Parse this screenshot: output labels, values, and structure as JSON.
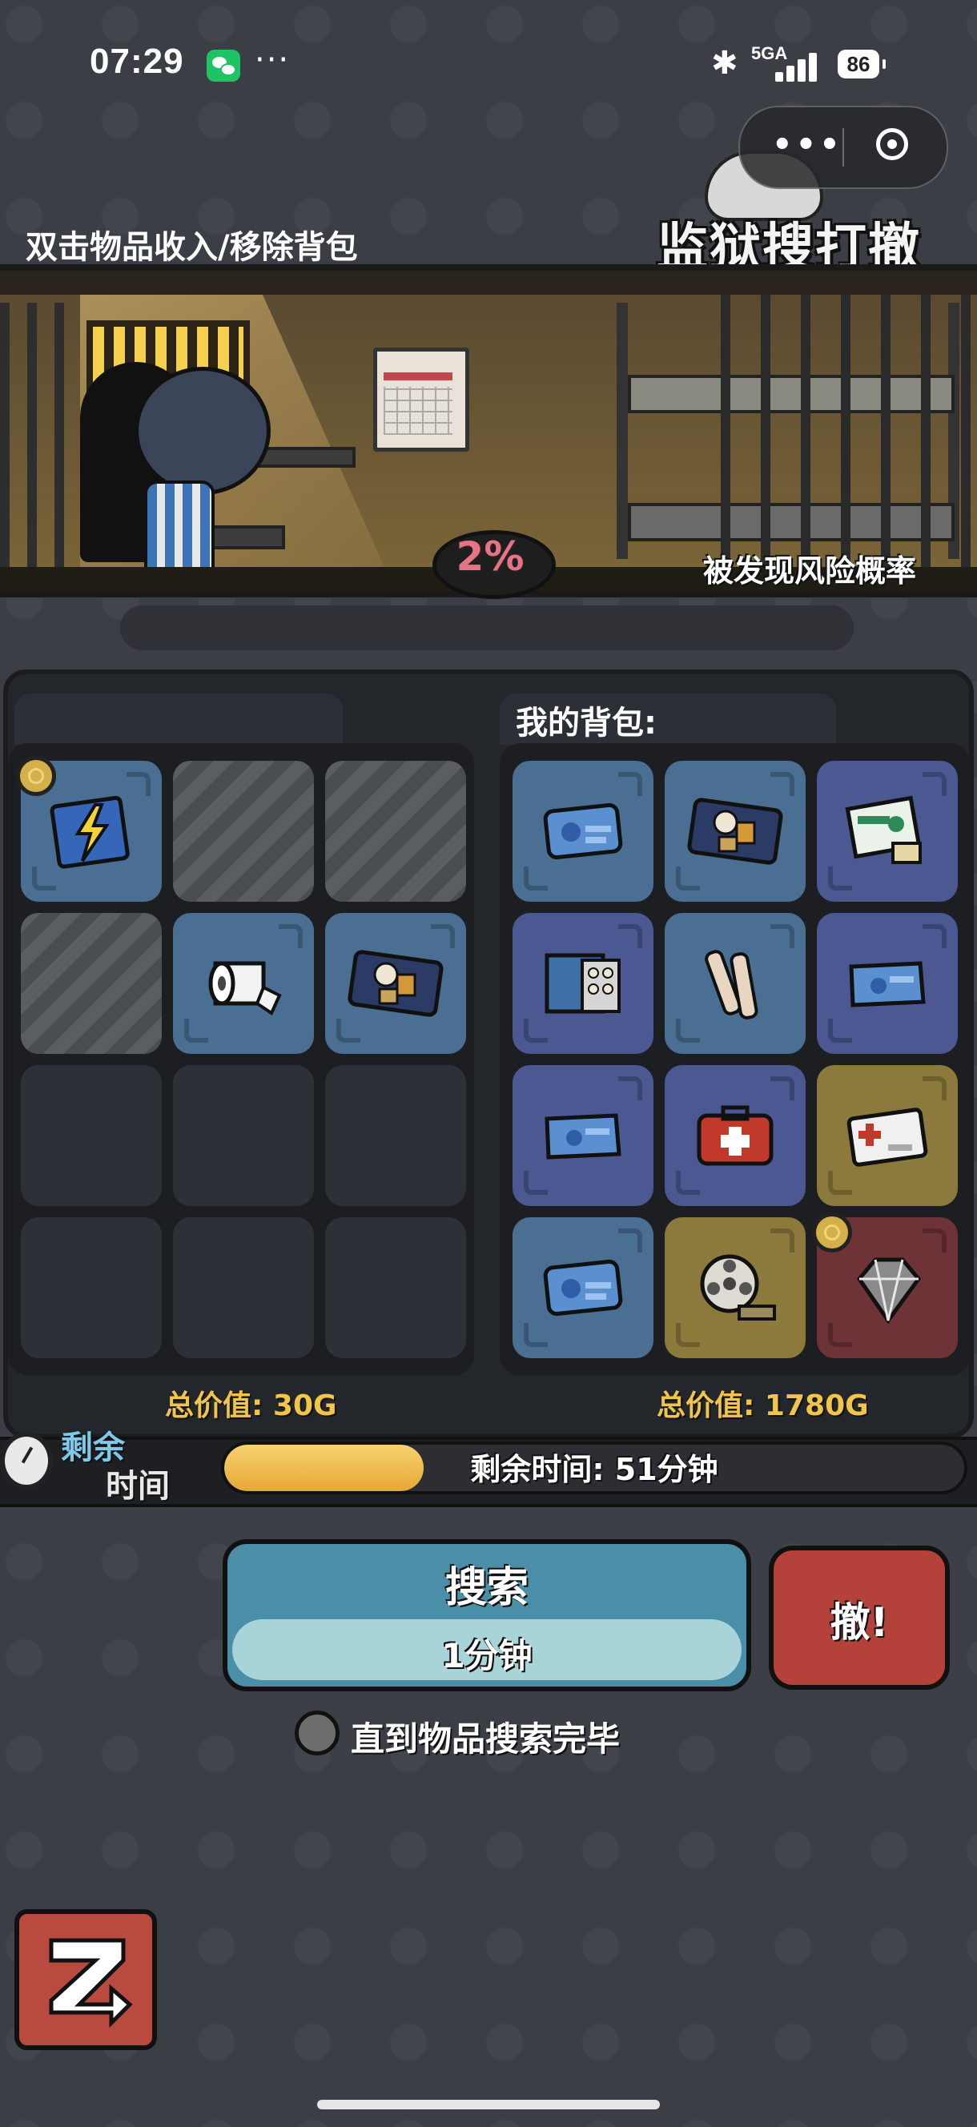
{
  "status": {
    "time": "07:29",
    "network": "5GA",
    "battery": "86"
  },
  "header": {
    "hint": "双击物品收入/移除背包",
    "game_logo": "监狱搜打撤"
  },
  "scene": {
    "risk_percent": "2%",
    "risk_label": "被发现风险概率"
  },
  "panels": {
    "right_title": "我的背包:",
    "left_total": "总价值: 30G",
    "right_total": "总价值: 1780G"
  },
  "left_grid": [
    {
      "state": "item",
      "color": "blue",
      "icon": "lightning-poster-icon",
      "coin": true
    },
    {
      "state": "hatched"
    },
    {
      "state": "hatched"
    },
    {
      "state": "hatched"
    },
    {
      "state": "item",
      "color": "blue",
      "icon": "toilet-paper-icon"
    },
    {
      "state": "item",
      "color": "blue",
      "icon": "food-bag-icon"
    },
    {
      "state": "empty"
    },
    {
      "state": "empty"
    },
    {
      "state": "empty"
    },
    {
      "state": "empty"
    },
    {
      "state": "empty"
    },
    {
      "state": "empty"
    }
  ],
  "right_grid": [
    {
      "state": "item",
      "color": "blue",
      "icon": "id-card-icon"
    },
    {
      "state": "item",
      "color": "blue",
      "icon": "food-bag-icon"
    },
    {
      "state": "item",
      "color": "purple",
      "icon": "medicine-box-icon"
    },
    {
      "state": "item",
      "color": "purple",
      "icon": "pill-pack-icon"
    },
    {
      "state": "item",
      "color": "blue",
      "icon": "bandage-icon"
    },
    {
      "state": "item",
      "color": "purple",
      "icon": "keycard-icon"
    },
    {
      "state": "item",
      "color": "purple",
      "icon": "keycard-icon"
    },
    {
      "state": "item",
      "color": "purple",
      "icon": "first-aid-kit-icon"
    },
    {
      "state": "item",
      "color": "gold",
      "icon": "medical-card-icon"
    },
    {
      "state": "item",
      "color": "blue",
      "icon": "id-card-icon"
    },
    {
      "state": "item",
      "color": "gold",
      "icon": "film-reel-icon"
    },
    {
      "state": "item",
      "color": "red",
      "icon": "diamond-icon",
      "coin": true
    }
  ],
  "timer": {
    "label_line1": "剩余",
    "label_line2": "时间",
    "text": "剩余时间: 51分钟",
    "progress": 0.27
  },
  "actions": {
    "search_label": "搜索",
    "search_duration": "1分钟",
    "withdraw_label": "撤!",
    "toggle_label": "直到物品搜索完毕"
  }
}
